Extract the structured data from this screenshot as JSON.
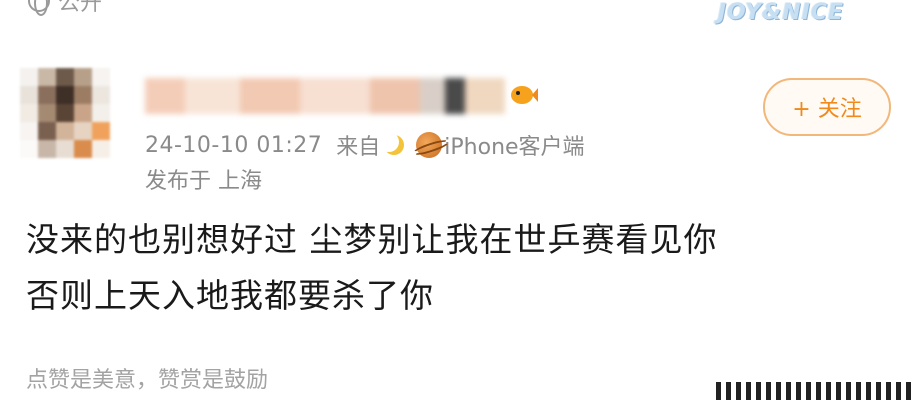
{
  "header": {
    "visibility_label": "公开",
    "visibility_icon": "globe-icon",
    "watermark": "JOY&NICE"
  },
  "post": {
    "follow_label": "+ 关注",
    "timestamp": "24-10-10 01:27",
    "from_label": "来自",
    "client_label": "iPhone客户端",
    "location": "发布于 上海",
    "body_lines": [
      "没来的也别想好过 尘梦别让我在世乒赛看见你",
      "否则上天入地我都要杀了你"
    ]
  },
  "footer": {
    "text": "点赞是美意，赞赏是鼓励"
  },
  "colors": {
    "accent": "#f08a1c",
    "meta_gray": "#8a8a8a",
    "body_text": "#1a1a1a"
  }
}
